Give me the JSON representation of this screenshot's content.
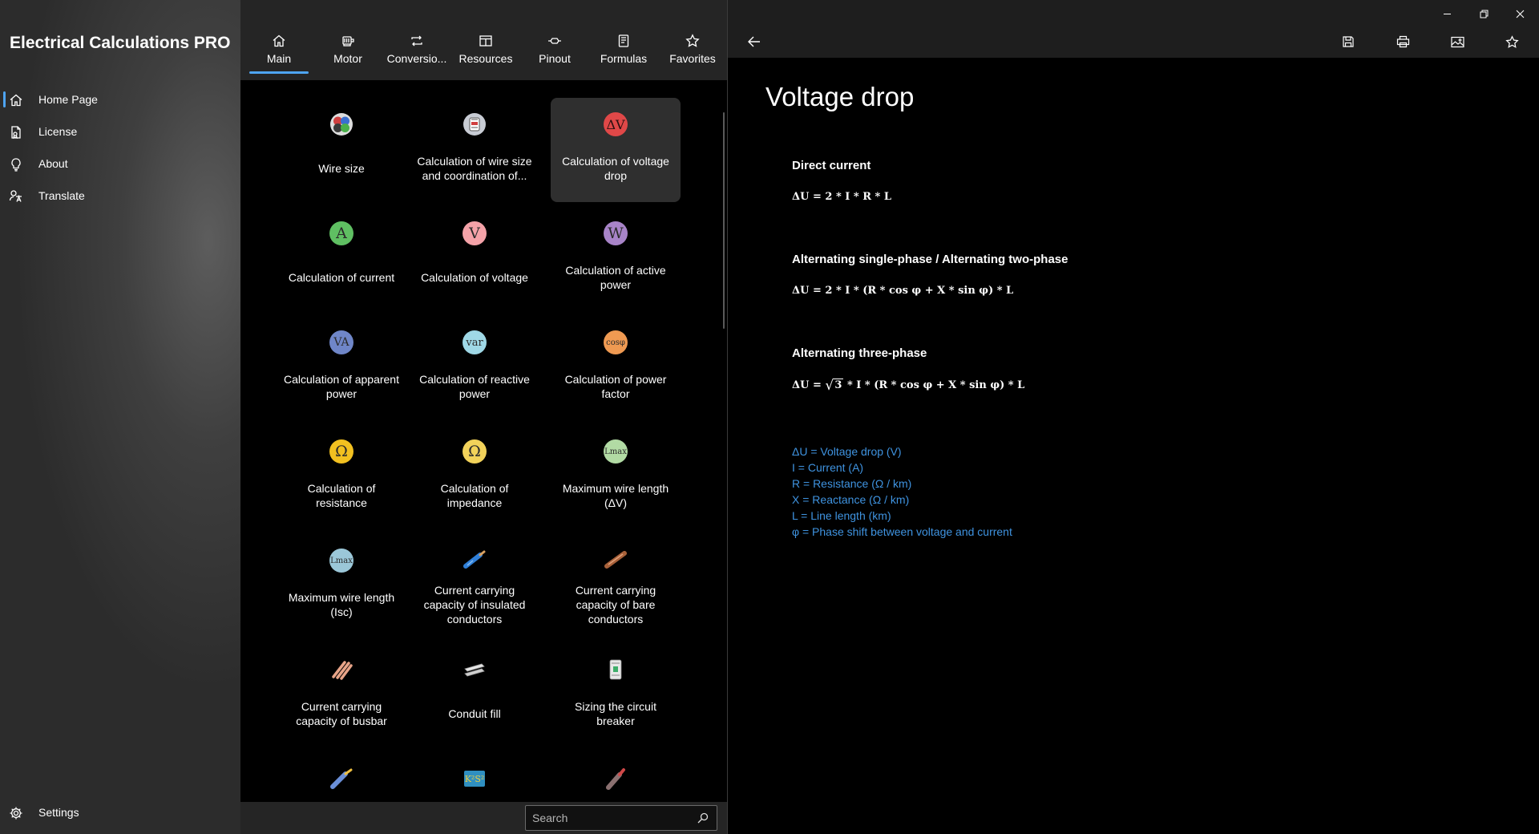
{
  "app": {
    "title": "Electrical Calculations PRO"
  },
  "nav": {
    "items": [
      {
        "label": "Home Page",
        "icon": "home-icon",
        "active": true
      },
      {
        "label": "License",
        "icon": "license-icon"
      },
      {
        "label": "About",
        "icon": "lightbulb-icon"
      },
      {
        "label": "Translate",
        "icon": "translate-icon"
      }
    ],
    "settings_label": "Settings"
  },
  "tabs": [
    {
      "label": "Main",
      "icon": "home-icon",
      "active": true
    },
    {
      "label": "Motor",
      "icon": "motor-icon"
    },
    {
      "label": "Conversio...",
      "icon": "conversion-icon"
    },
    {
      "label": "Resources",
      "icon": "resources-icon"
    },
    {
      "label": "Pinout",
      "icon": "pinout-icon"
    },
    {
      "label": "Formulas",
      "icon": "formulas-icon"
    },
    {
      "label": "Favorites",
      "icon": "star-icon"
    }
  ],
  "tiles": [
    {
      "label": "Wire size",
      "icon": "wire-size-icon"
    },
    {
      "label": "Calculation of wire size and coordination of...",
      "icon": "wire-coordination-icon"
    },
    {
      "label": "Calculation of voltage drop",
      "icon": "voltage-drop-icon",
      "symbol": "ΔV",
      "color": "#e04848",
      "selected": true
    },
    {
      "label": "Calculation of current",
      "icon": "current-icon",
      "symbol": "A",
      "color": "#5fbf62"
    },
    {
      "label": "Calculation of voltage",
      "icon": "voltage-icon",
      "symbol": "V",
      "color": "#f4a2a8"
    },
    {
      "label": "Calculation of active power",
      "icon": "active-power-icon",
      "symbol": "W",
      "color": "#a884c8"
    },
    {
      "label": "Calculation of apparent power",
      "icon": "apparent-power-icon",
      "symbol": "VA",
      "color": "#6f86c8"
    },
    {
      "label": "Calculation of reactive power",
      "icon": "reactive-power-icon",
      "symbol": "var",
      "color": "#9fd8e6"
    },
    {
      "label": "Calculation of power factor",
      "icon": "power-factor-icon",
      "symbol": "cosφ",
      "color": "#ef9a52"
    },
    {
      "label": "Calculation of resistance",
      "icon": "resistance-icon",
      "symbol": "Ω",
      "color": "#f2c020"
    },
    {
      "label": "Calculation of impedance",
      "icon": "impedance-icon",
      "symbol": "Ω",
      "color": "#f2d25a"
    },
    {
      "label": "Maximum wire length (ΔV)",
      "icon": "max-length-dv-icon",
      "symbol": "Lmax",
      "color": "#b2dba4"
    },
    {
      "label": "Maximum wire length (Isc)",
      "icon": "max-length-isc-icon",
      "symbol": "Lmax",
      "color": "#9bc7d8"
    },
    {
      "label": "Current carrying capacity of insulated conductors",
      "icon": "insulated-conductor-icon"
    },
    {
      "label": "Current carrying capacity of bare conductors",
      "icon": "bare-conductor-icon"
    },
    {
      "label": "Current carrying capacity of busbar",
      "icon": "busbar-icon"
    },
    {
      "label": "Conduit fill",
      "icon": "conduit-icon"
    },
    {
      "label": "Sizing the circuit breaker",
      "icon": "circuit-breaker-icon"
    },
    {
      "label": "",
      "icon": "cable-icon"
    },
    {
      "label": "",
      "icon": "ksr-icon"
    },
    {
      "label": "",
      "icon": "cable-end-icon"
    }
  ],
  "search": {
    "placeholder": "Search"
  },
  "detail": {
    "title": "Voltage drop",
    "sections": [
      {
        "heading": "Direct current",
        "formula": "ΔU = 2 * I * R * L"
      },
      {
        "heading": "Alternating single-phase / Alternating two-phase",
        "formula": "ΔU = 2 * I * (R * cos φ + X * sin φ) * L"
      },
      {
        "heading": "Alternating three-phase",
        "formula_prefix": "ΔU = ",
        "formula_root": "3",
        "formula_suffix": " * I * (R * cos φ + X * sin φ) * L"
      }
    ],
    "legend": [
      "ΔU = Voltage drop (V)",
      "I = Current (A)",
      "R = Resistance (Ω / km)",
      "X = Reactance (Ω / km)",
      "L = Line length (km)",
      "φ = Phase shift between voltage and current"
    ]
  },
  "colors": {
    "accent": "#4ea4f1",
    "legend": "#3f93e0"
  }
}
